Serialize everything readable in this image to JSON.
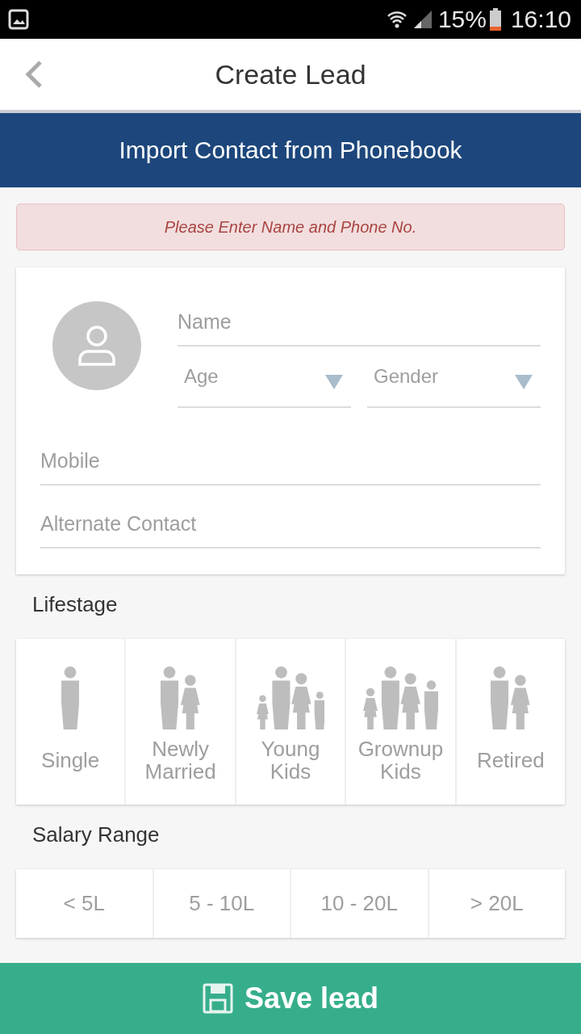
{
  "status_bar": {
    "battery": "15%",
    "time": "16:10"
  },
  "header": {
    "title": "Create Lead"
  },
  "import_button": "Import Contact from Phonebook",
  "alert": "Please Enter Name and Phone No.",
  "contact_form": {
    "name": {
      "placeholder": "Name"
    },
    "age": {
      "placeholder": "Age"
    },
    "gender": {
      "placeholder": "Gender"
    },
    "mobile": {
      "placeholder": "Mobile"
    },
    "alternate_contact": {
      "placeholder": "Alternate Contact"
    }
  },
  "lifestage": {
    "title": "Lifestage",
    "items": [
      {
        "label": "Single",
        "kind": "single"
      },
      {
        "label": "Newly Married",
        "kind": "couple"
      },
      {
        "label": "Young Kids",
        "kind": "young"
      },
      {
        "label": "Grownup Kids",
        "kind": "grownup"
      },
      {
        "label": "Retired",
        "kind": "couple"
      }
    ]
  },
  "salary_range": {
    "title": "Salary Range",
    "options": [
      "< 5L",
      "5 - 10L",
      "10 - 20L",
      "> 20L"
    ]
  },
  "save_button": "Save lead"
}
